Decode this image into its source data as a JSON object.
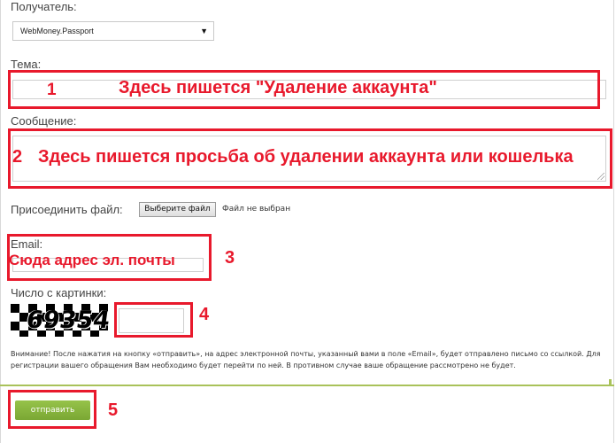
{
  "form": {
    "recipient_label": "Получатель:",
    "recipient_value": "WebMoney.Passport",
    "subject_label": "Тема:",
    "message_label": "Сообщение:",
    "attach_label": "Присоединить файл:",
    "file_button": "Выберите файл",
    "file_status": "Файл не выбран",
    "email_label": "Email:",
    "captcha_label": "Число с картинки:",
    "captcha_code": "69354",
    "notice": "Внимание! После нажатия на кнопку «отправить», на адрес электронной почты, указанный вами в поле «Email», будет отправлено письмо со ссылкой. Для регистрации вашего обращения Вам необходимо будет перейти по ней. В противном случае ваше обращение рассмотрено не будет.",
    "submit_label": "отправить"
  },
  "annotations": {
    "n1": "1",
    "t1": "Здесь пишется \"Удаление аккаунта\"",
    "n2": "2",
    "t2": "Здесь пишется просьба об удалении аккаунта или кошелька",
    "n3": "3",
    "t3": "Сюда адрес эл. почты",
    "n4": "4",
    "n5": "5"
  },
  "colors": {
    "annotation_red": "#e8192c",
    "submit_green": "#8bb83f",
    "divider_green": "#a9c25a"
  }
}
